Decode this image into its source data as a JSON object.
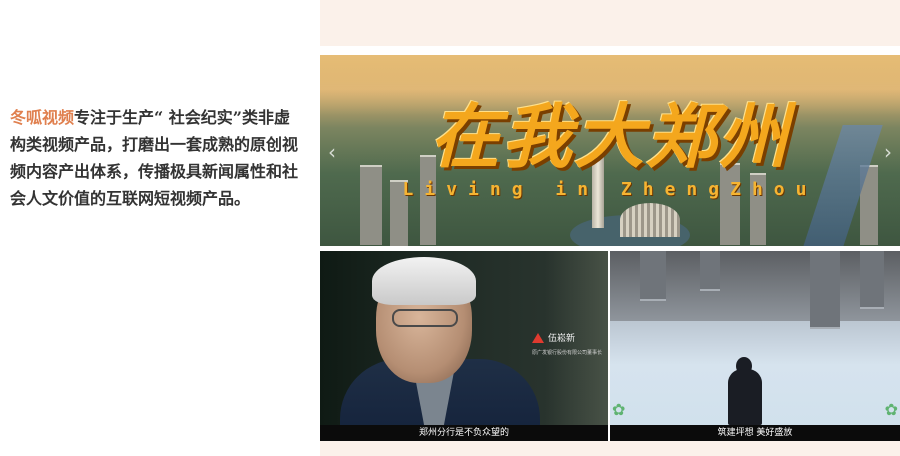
{
  "intro": {
    "brand": "冬呱视频",
    "text": "专注于生产“ 社会纪实”类非虚构类视频产品，打磨出一套成熟的原创视频内容产出体系，传播极具新闻属性和社会人文价值的互联网短视频产品。"
  },
  "banner": {
    "title": "在我大郑州",
    "subtitle": "Living in ZhengZhou",
    "prev_icon": "chevron-left-icon",
    "next_icon": "chevron-right-icon"
  },
  "tiles": [
    {
      "caption": "郑州分行是不负众望的",
      "name_tag": "伍崧新",
      "role": "原广发银行股份有限公司董事长"
    },
    {
      "caption": "筑建坪想 美好盛放"
    }
  ],
  "colors": {
    "brand": "#e0804f",
    "banner_title": "#f4a71d",
    "strip": "#fbf1ea"
  }
}
